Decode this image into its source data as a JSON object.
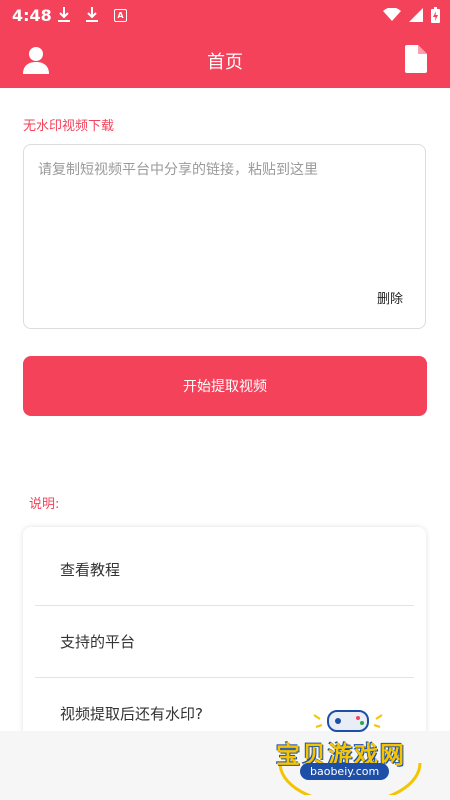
{
  "status_bar": {
    "time": "4:48",
    "a_badge": "A"
  },
  "app_bar": {
    "title": "首页"
  },
  "main": {
    "section_title": "无水印视频下载",
    "input_placeholder": "请复制短视频平台中分享的链接，粘贴到这里",
    "input_value": "",
    "delete_label": "删除",
    "start_button": "开始提取视频"
  },
  "explain": {
    "title": "说明:",
    "items": [
      {
        "label": "查看教程"
      },
      {
        "label": "支持的平台"
      },
      {
        "label": "视频提取后还有水印?"
      }
    ]
  },
  "watermark": {
    "title": "宝贝游戏网",
    "url": "baobeiy.com"
  },
  "colors": {
    "accent": "#f4425b",
    "watermark_yellow": "#f5c400",
    "watermark_blue": "#1e4fa8"
  }
}
